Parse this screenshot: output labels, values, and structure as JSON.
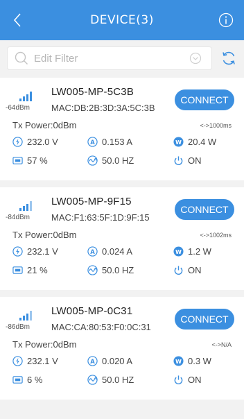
{
  "header": {
    "title": "DEVICE(3)",
    "back_icon": "chevron-left-icon",
    "info_icon": "info-icon",
    "color": "#3b8fe0"
  },
  "filter": {
    "placeholder": "Edit Filter",
    "search_icon": "search-icon",
    "dropdown_icon": "chevron-down-circle-icon",
    "refresh_icon": "refresh-icon"
  },
  "devices": [
    {
      "rssi": "-64dBm",
      "name": "LW005-MP-5C3B",
      "mac": "MAC:DB:2B:3D:3A:5C:3B",
      "connect_label": "CONNECT",
      "tx_power": "Tx Power:0dBm",
      "interval": "<->1000ms",
      "voltage": "232.0 V",
      "current": "0.153 A",
      "power": "20.4 W",
      "power_factor": "57 %",
      "frequency": "50.0 HZ",
      "switch": "ON"
    },
    {
      "rssi": "-84dBm",
      "name": "LW005-MP-9F15",
      "mac": "MAC:F1:63:5F:1D:9F:15",
      "connect_label": "CONNECT",
      "tx_power": "Tx Power:0dBm",
      "interval": "<->1002ms",
      "voltage": "232.1 V",
      "current": "0.024 A",
      "power": "1.2 W",
      "power_factor": "21 %",
      "frequency": "50.0 HZ",
      "switch": "ON"
    },
    {
      "rssi": "-86dBm",
      "name": "LW005-MP-0C31",
      "mac": "MAC:CA:80:53:F0:0C:31",
      "connect_label": "CONNECT",
      "tx_power": "Tx Power:0dBm",
      "interval": "<->N/A",
      "voltage": "232.1 V",
      "current": "0.020 A",
      "power": "0.3 W",
      "power_factor": "6 %",
      "frequency": "50.0 HZ",
      "switch": "ON"
    }
  ]
}
